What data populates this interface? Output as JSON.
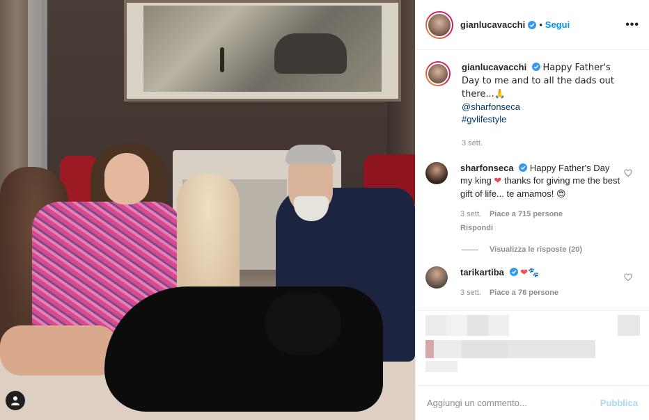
{
  "post": {
    "author": "gianlucavacchi",
    "follow_label": "Segui",
    "separator": "•",
    "more_label": "•••"
  },
  "caption": {
    "username": "gianlucavacchi",
    "text": "Happy Father's Day to me and to all the dads out there...🙏",
    "mention": "@sharfonseca",
    "hashtag": "#gvlifestyle",
    "time": "3 sett."
  },
  "comments": [
    {
      "username": "sharfonseca",
      "text_part1": "Happy Father's Day my king",
      "emoji1": "❤",
      "text_part2": "thanks for giving me the best gift of life... te amamos!",
      "emoji2": "😍",
      "time": "3 sett.",
      "likes": "Piace a 715 persone",
      "reply": "Rispondi",
      "view_replies": "Visualizza le risposte (20)"
    },
    {
      "username": "tarikartiba",
      "text": "❤🐾",
      "time": "3 sett.",
      "likes": "Piace a 76 persone"
    }
  ],
  "add_comment": {
    "placeholder": "Aggiungi un commento...",
    "publish_label": "Pubblica"
  },
  "colors": {
    "accent": "#0095f6",
    "heart": "#ed4956",
    "verified": "#3897f0"
  }
}
